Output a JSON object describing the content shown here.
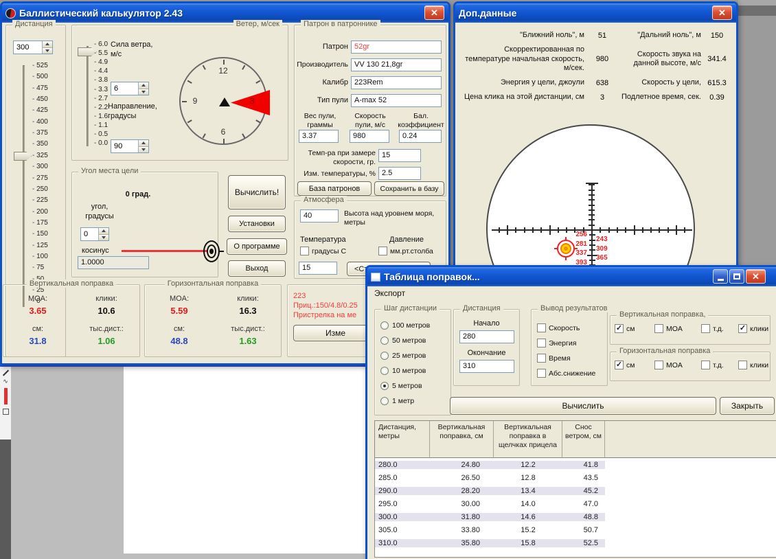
{
  "icons": {
    "check": "✓",
    "close": "✕"
  },
  "colors": {
    "titlebar": "#0e58d8",
    "window_bg": "#ece9d8",
    "red": "#e51a1a",
    "blue": "#2a46c0",
    "green": "#259a25",
    "close_btn": "#d6492f"
  },
  "main_window": {
    "title": "Баллистический калькулятор 2.43",
    "distance": {
      "label": "Дистанция",
      "value": "300",
      "scale": [
        "525",
        "500",
        "475",
        "450",
        "425",
        "400",
        "375",
        "350",
        "325",
        "300",
        "275",
        "250",
        "225",
        "200",
        "175",
        "150",
        "125",
        "100",
        "75",
        "50",
        "25",
        "0"
      ]
    },
    "wind": {
      "label": "Ветер, м/сек",
      "force_label": "Сила ветра,",
      "force_units": "м/с",
      "force_value": "6",
      "direction_label": "Направление,",
      "direction_units": "градусы",
      "direction_value": "90",
      "scale": [
        "6.0",
        "5.5",
        "4.9",
        "4.4",
        "3.8",
        "3.3",
        "2.7",
        "2.2",
        "1.6",
        "1.1",
        "0.5",
        "0.0"
      ],
      "dial_numbers": [
        "12",
        "3",
        "6",
        "9"
      ]
    },
    "angle": {
      "label": "Угол места цели",
      "value_label": "0 град.",
      "angle_label": "угол,",
      "angle_units": "градусы",
      "angle_value": "0",
      "cos_label": "косинус",
      "cos_value": "1.0000"
    },
    "buttons": {
      "calculate": "Вычислить!",
      "settings": "Установки",
      "about": "О программе",
      "exit": "Выход"
    },
    "cartridge": {
      "label": "Патрон в патроннике",
      "cartridge_label": "Патрон",
      "cartridge_value": "52gr",
      "manufacturer_label": "Производитель",
      "manufacturer_value": "VV 130 21,8gr",
      "caliber_label": "Калибр",
      "caliber_value": "223Rem",
      "bullet_type_label": "Тип пули",
      "bullet_type_value": "A-max 52",
      "weight_label": "Вес пули, граммы",
      "weight_value": "3.37",
      "speed_label": "Скорость пули, м/с",
      "speed_value": "980",
      "bc_label": "Бал. коэффициент",
      "bc_value": "0.24",
      "temp_label": "Темп-ра при замере скорости, гр.",
      "temp_value": "15",
      "temp_change_label": "Изм. температуры, %",
      "temp_change_value": "2.5",
      "db_button": "База патронов",
      "save_button": "Сохранить в базу"
    },
    "atmosphere": {
      "label": "Атмосфера",
      "altitude_value": "40",
      "altitude_label": "Высота над уровнем моря, метры",
      "temperature_label": "Температура",
      "celsius_label": "градусы C",
      "pressure_label": "Давление",
      "mmhg_label": "мм.рт.столба",
      "temp_value": "15",
      "std_button": "<Станд"
    },
    "vertical_correction": {
      "label": "Вертикальная поправка",
      "moa_label": "MOA:",
      "moa_value": "3.65",
      "clicks_label": "клики:",
      "clicks_value": "10.6",
      "cm_label": "см:",
      "cm_value": "31.8",
      "mil_label": "тыс.дист.:",
      "mil_value": "1.06"
    },
    "horizontal_correction": {
      "label": "Горизонтальная поправка",
      "moa_label": "MOA:",
      "moa_value": "5.59",
      "clicks_label": "клики:",
      "clicks_value": "16.3",
      "cm_label": "см:",
      "cm_value": "48.8",
      "mil_label": "тыс.дист.:",
      "mil_value": "1.63"
    },
    "zero_info": {
      "line1": "223",
      "line2": "Приц.:150/4.8/0.25",
      "line3": "Пристрелка на ме",
      "change_button": "Изме"
    }
  },
  "extra_window": {
    "title": "Доп.данные",
    "stats_rows": [
      {
        "l1": "\"Ближний ноль\", м",
        "v1": "51",
        "l2": "\"Дальний ноль\", м",
        "v2": "150"
      },
      {
        "l1": "Скорректированная по температуре начальная скорость, м/сек.",
        "v1": "980",
        "l2": "Скорость звука на данной высоте, м/с",
        "v2": "341.4"
      },
      {
        "l1": "Энергия у цели, джоули",
        "v1": "638",
        "l2": "Скорость у цели,",
        "v2": "615.3"
      },
      {
        "l1": "Цена клика на этой дистанции, см",
        "v1": "3",
        "l2": "Подлетное время, сек.",
        "v2": "0.39"
      }
    ],
    "reticle": {
      "left_numbers": [
        "256",
        "281",
        "337",
        "393"
      ],
      "right_numbers": [
        "243",
        "309",
        "365"
      ]
    }
  },
  "table_window": {
    "title": "Таблица поправок...",
    "menu": {
      "export": "Экспорт"
    },
    "step_group": {
      "label": "Шаг дистанции",
      "options": [
        "100 метров",
        "50 метров",
        "25 метров",
        "10 метров",
        "5 метров",
        "1 метр"
      ],
      "selected_index": 4
    },
    "range_group": {
      "label": "Дистанция",
      "start_label": "Начало",
      "start_value": "280",
      "end_label": "Окончание",
      "end_value": "310"
    },
    "output_group": {
      "label": "Вывод результатов",
      "options": [
        {
          "label": "Скорость",
          "checked": false
        },
        {
          "label": "Энергия",
          "checked": false
        },
        {
          "label": "Время",
          "checked": false
        },
        {
          "label": "Абс.снижение",
          "checked": false
        }
      ]
    },
    "vertical_group": {
      "label": "Вертикальная поправка,",
      "options": [
        {
          "label": "см",
          "checked": true
        },
        {
          "label": "MOA",
          "checked": false
        },
        {
          "label": "т.д.",
          "checked": false
        },
        {
          "label": "клики",
          "checked": true
        }
      ]
    },
    "horizontal_group": {
      "label": "Горизонтальная поправка",
      "options": [
        {
          "label": "см",
          "checked": true
        },
        {
          "label": "MOA",
          "checked": false
        },
        {
          "label": "т.д.",
          "checked": false
        },
        {
          "label": "клики",
          "checked": false
        }
      ]
    },
    "calculate_button": "Вычислить",
    "close_button": "Закрыть",
    "table": {
      "headers": [
        "Дистанция, метры",
        "Вертикальная поправка, см",
        "Вертикальная поправка в щелчках прицела",
        "Снос ветром, см"
      ],
      "rows": [
        [
          "280.0",
          "24.80",
          "12.2",
          "41.8"
        ],
        [
          "285.0",
          "26.50",
          "12.8",
          "43.5"
        ],
        [
          "290.0",
          "28.20",
          "13.4",
          "45.2"
        ],
        [
          "295.0",
          "30.00",
          "14.0",
          "47.0"
        ],
        [
          "300.0",
          "31.80",
          "14.6",
          "48.8"
        ],
        [
          "305.0",
          "33.80",
          "15.2",
          "50.7"
        ],
        [
          "310.0",
          "35.80",
          "15.8",
          "52.5"
        ]
      ]
    }
  }
}
